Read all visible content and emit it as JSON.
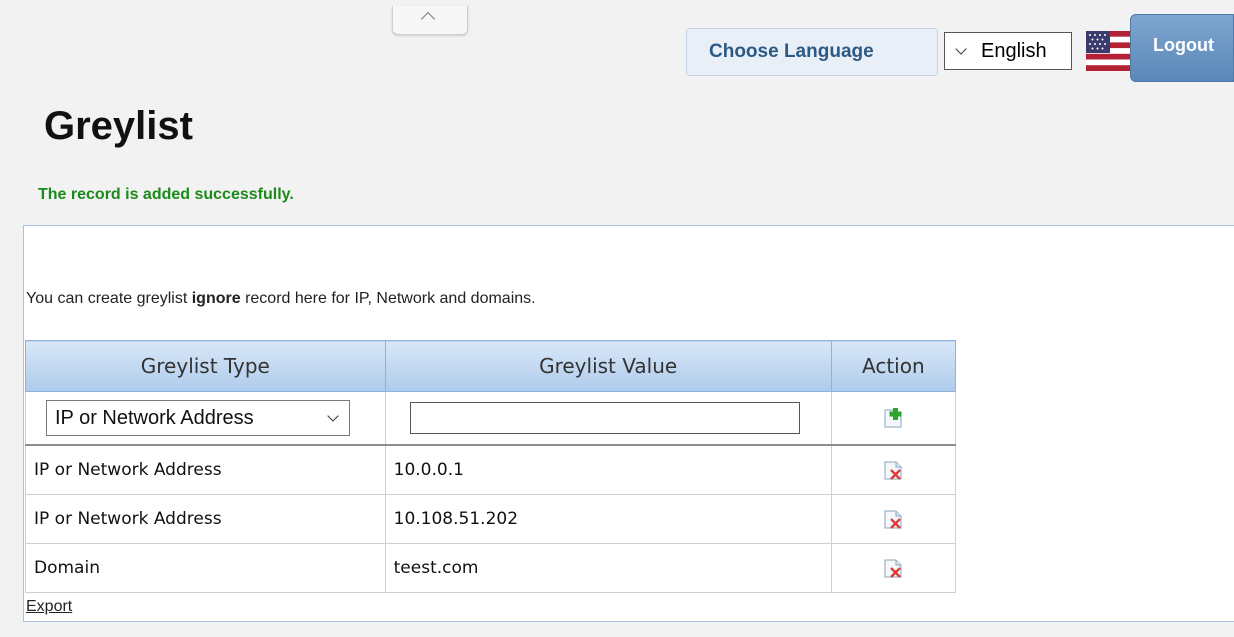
{
  "language": {
    "label": "Choose Language",
    "selected": "English"
  },
  "logout_label": "Logout",
  "page_title": "Greylist",
  "status_message": "The record is added successfully.",
  "description": {
    "before": "You can create greylist ",
    "emphasis": "ignore",
    "after": " record here for IP, Network and domains."
  },
  "table": {
    "headers": [
      "Greylist Type",
      "Greylist Value",
      "Action"
    ],
    "new_row": {
      "type_selected": "IP or Network Address",
      "value": ""
    },
    "rows": [
      {
        "type": "IP or Network Address",
        "value": "10.0.0.1"
      },
      {
        "type": "IP or Network Address",
        "value": "10.108.51.202"
      },
      {
        "type": "Domain",
        "value": "teest.com"
      }
    ]
  },
  "export_label": "Export",
  "icons": {
    "collapse": "chevron-up-icon",
    "flag": "us-flag-icon",
    "add": "add-record-icon",
    "delete": "delete-record-icon"
  },
  "colors": {
    "success": "#1a8a1a",
    "header_blue": "#aecbeb",
    "logout_blue": "#5b87b8"
  }
}
